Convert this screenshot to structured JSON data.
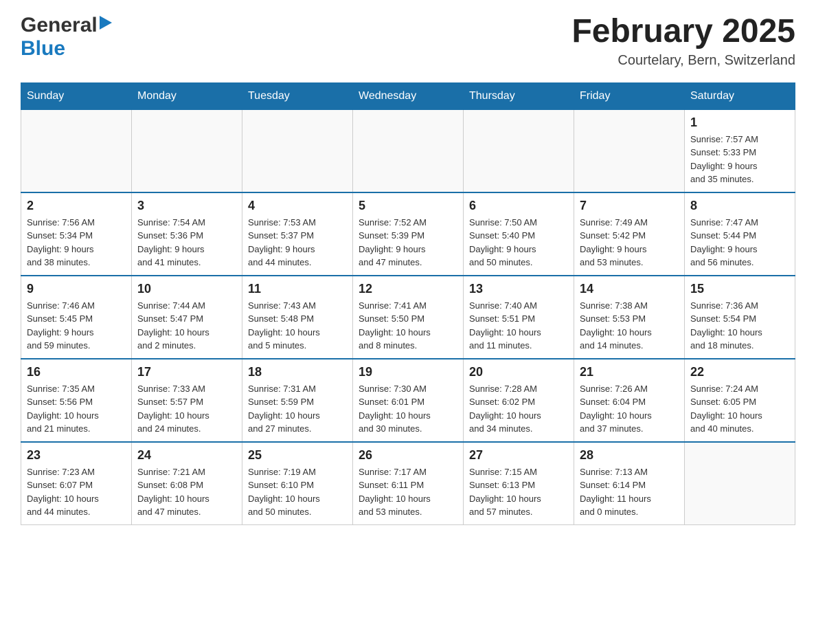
{
  "header": {
    "logo_general": "General",
    "logo_blue": "Blue",
    "month_title": "February 2025",
    "location": "Courtelary, Bern, Switzerland"
  },
  "weekdays": [
    "Sunday",
    "Monday",
    "Tuesday",
    "Wednesday",
    "Thursday",
    "Friday",
    "Saturday"
  ],
  "weeks": [
    {
      "days": [
        {
          "number": "",
          "info": ""
        },
        {
          "number": "",
          "info": ""
        },
        {
          "number": "",
          "info": ""
        },
        {
          "number": "",
          "info": ""
        },
        {
          "number": "",
          "info": ""
        },
        {
          "number": "",
          "info": ""
        },
        {
          "number": "1",
          "info": "Sunrise: 7:57 AM\nSunset: 5:33 PM\nDaylight: 9 hours\nand 35 minutes."
        }
      ]
    },
    {
      "days": [
        {
          "number": "2",
          "info": "Sunrise: 7:56 AM\nSunset: 5:34 PM\nDaylight: 9 hours\nand 38 minutes."
        },
        {
          "number": "3",
          "info": "Sunrise: 7:54 AM\nSunset: 5:36 PM\nDaylight: 9 hours\nand 41 minutes."
        },
        {
          "number": "4",
          "info": "Sunrise: 7:53 AM\nSunset: 5:37 PM\nDaylight: 9 hours\nand 44 minutes."
        },
        {
          "number": "5",
          "info": "Sunrise: 7:52 AM\nSunset: 5:39 PM\nDaylight: 9 hours\nand 47 minutes."
        },
        {
          "number": "6",
          "info": "Sunrise: 7:50 AM\nSunset: 5:40 PM\nDaylight: 9 hours\nand 50 minutes."
        },
        {
          "number": "7",
          "info": "Sunrise: 7:49 AM\nSunset: 5:42 PM\nDaylight: 9 hours\nand 53 minutes."
        },
        {
          "number": "8",
          "info": "Sunrise: 7:47 AM\nSunset: 5:44 PM\nDaylight: 9 hours\nand 56 minutes."
        }
      ]
    },
    {
      "days": [
        {
          "number": "9",
          "info": "Sunrise: 7:46 AM\nSunset: 5:45 PM\nDaylight: 9 hours\nand 59 minutes."
        },
        {
          "number": "10",
          "info": "Sunrise: 7:44 AM\nSunset: 5:47 PM\nDaylight: 10 hours\nand 2 minutes."
        },
        {
          "number": "11",
          "info": "Sunrise: 7:43 AM\nSunset: 5:48 PM\nDaylight: 10 hours\nand 5 minutes."
        },
        {
          "number": "12",
          "info": "Sunrise: 7:41 AM\nSunset: 5:50 PM\nDaylight: 10 hours\nand 8 minutes."
        },
        {
          "number": "13",
          "info": "Sunrise: 7:40 AM\nSunset: 5:51 PM\nDaylight: 10 hours\nand 11 minutes."
        },
        {
          "number": "14",
          "info": "Sunrise: 7:38 AM\nSunset: 5:53 PM\nDaylight: 10 hours\nand 14 minutes."
        },
        {
          "number": "15",
          "info": "Sunrise: 7:36 AM\nSunset: 5:54 PM\nDaylight: 10 hours\nand 18 minutes."
        }
      ]
    },
    {
      "days": [
        {
          "number": "16",
          "info": "Sunrise: 7:35 AM\nSunset: 5:56 PM\nDaylight: 10 hours\nand 21 minutes."
        },
        {
          "number": "17",
          "info": "Sunrise: 7:33 AM\nSunset: 5:57 PM\nDaylight: 10 hours\nand 24 minutes."
        },
        {
          "number": "18",
          "info": "Sunrise: 7:31 AM\nSunset: 5:59 PM\nDaylight: 10 hours\nand 27 minutes."
        },
        {
          "number": "19",
          "info": "Sunrise: 7:30 AM\nSunset: 6:01 PM\nDaylight: 10 hours\nand 30 minutes."
        },
        {
          "number": "20",
          "info": "Sunrise: 7:28 AM\nSunset: 6:02 PM\nDaylight: 10 hours\nand 34 minutes."
        },
        {
          "number": "21",
          "info": "Sunrise: 7:26 AM\nSunset: 6:04 PM\nDaylight: 10 hours\nand 37 minutes."
        },
        {
          "number": "22",
          "info": "Sunrise: 7:24 AM\nSunset: 6:05 PM\nDaylight: 10 hours\nand 40 minutes."
        }
      ]
    },
    {
      "days": [
        {
          "number": "23",
          "info": "Sunrise: 7:23 AM\nSunset: 6:07 PM\nDaylight: 10 hours\nand 44 minutes."
        },
        {
          "number": "24",
          "info": "Sunrise: 7:21 AM\nSunset: 6:08 PM\nDaylight: 10 hours\nand 47 minutes."
        },
        {
          "number": "25",
          "info": "Sunrise: 7:19 AM\nSunset: 6:10 PM\nDaylight: 10 hours\nand 50 minutes."
        },
        {
          "number": "26",
          "info": "Sunrise: 7:17 AM\nSunset: 6:11 PM\nDaylight: 10 hours\nand 53 minutes."
        },
        {
          "number": "27",
          "info": "Sunrise: 7:15 AM\nSunset: 6:13 PM\nDaylight: 10 hours\nand 57 minutes."
        },
        {
          "number": "28",
          "info": "Sunrise: 7:13 AM\nSunset: 6:14 PM\nDaylight: 11 hours\nand 0 minutes."
        },
        {
          "number": "",
          "info": ""
        }
      ]
    }
  ]
}
